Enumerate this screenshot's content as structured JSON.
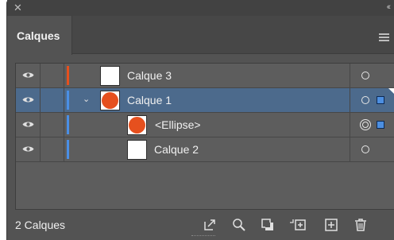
{
  "panel": {
    "tab_label": "Calques",
    "footer_label": "2 Calques"
  },
  "layers": [
    {
      "name": "Calque 3",
      "color": "#e6501e",
      "indent": 0,
      "expanded": false,
      "thumb": "blank",
      "selected": false
    },
    {
      "name": "Calque 1",
      "color": "#4a8fe6",
      "indent": 0,
      "expanded": true,
      "thumb": "circle",
      "selected": true
    },
    {
      "name": "<Ellipse>",
      "color": "#4a8fe6",
      "indent": 1,
      "expanded": false,
      "thumb": "circle",
      "selected": false
    },
    {
      "name": "Calque 2",
      "color": "#4a8fe6",
      "indent": 1,
      "expanded": false,
      "thumb": "blank",
      "selected": false
    }
  ],
  "icons": {
    "close": "close-icon",
    "collapse": "collapse-icon",
    "menu": "panel-menu-icon",
    "visibility": "eye-icon",
    "target": "target-icon",
    "footer_tools": [
      "export-icon",
      "locate-object-icon",
      "clipping-mask-icon",
      "new-sublayer-icon",
      "new-layer-icon",
      "delete-icon"
    ]
  },
  "colors": {
    "selection_row": "#4c6a8c",
    "selection_square": "#4d8fe0",
    "ellipse_fill": "#e6501e"
  }
}
